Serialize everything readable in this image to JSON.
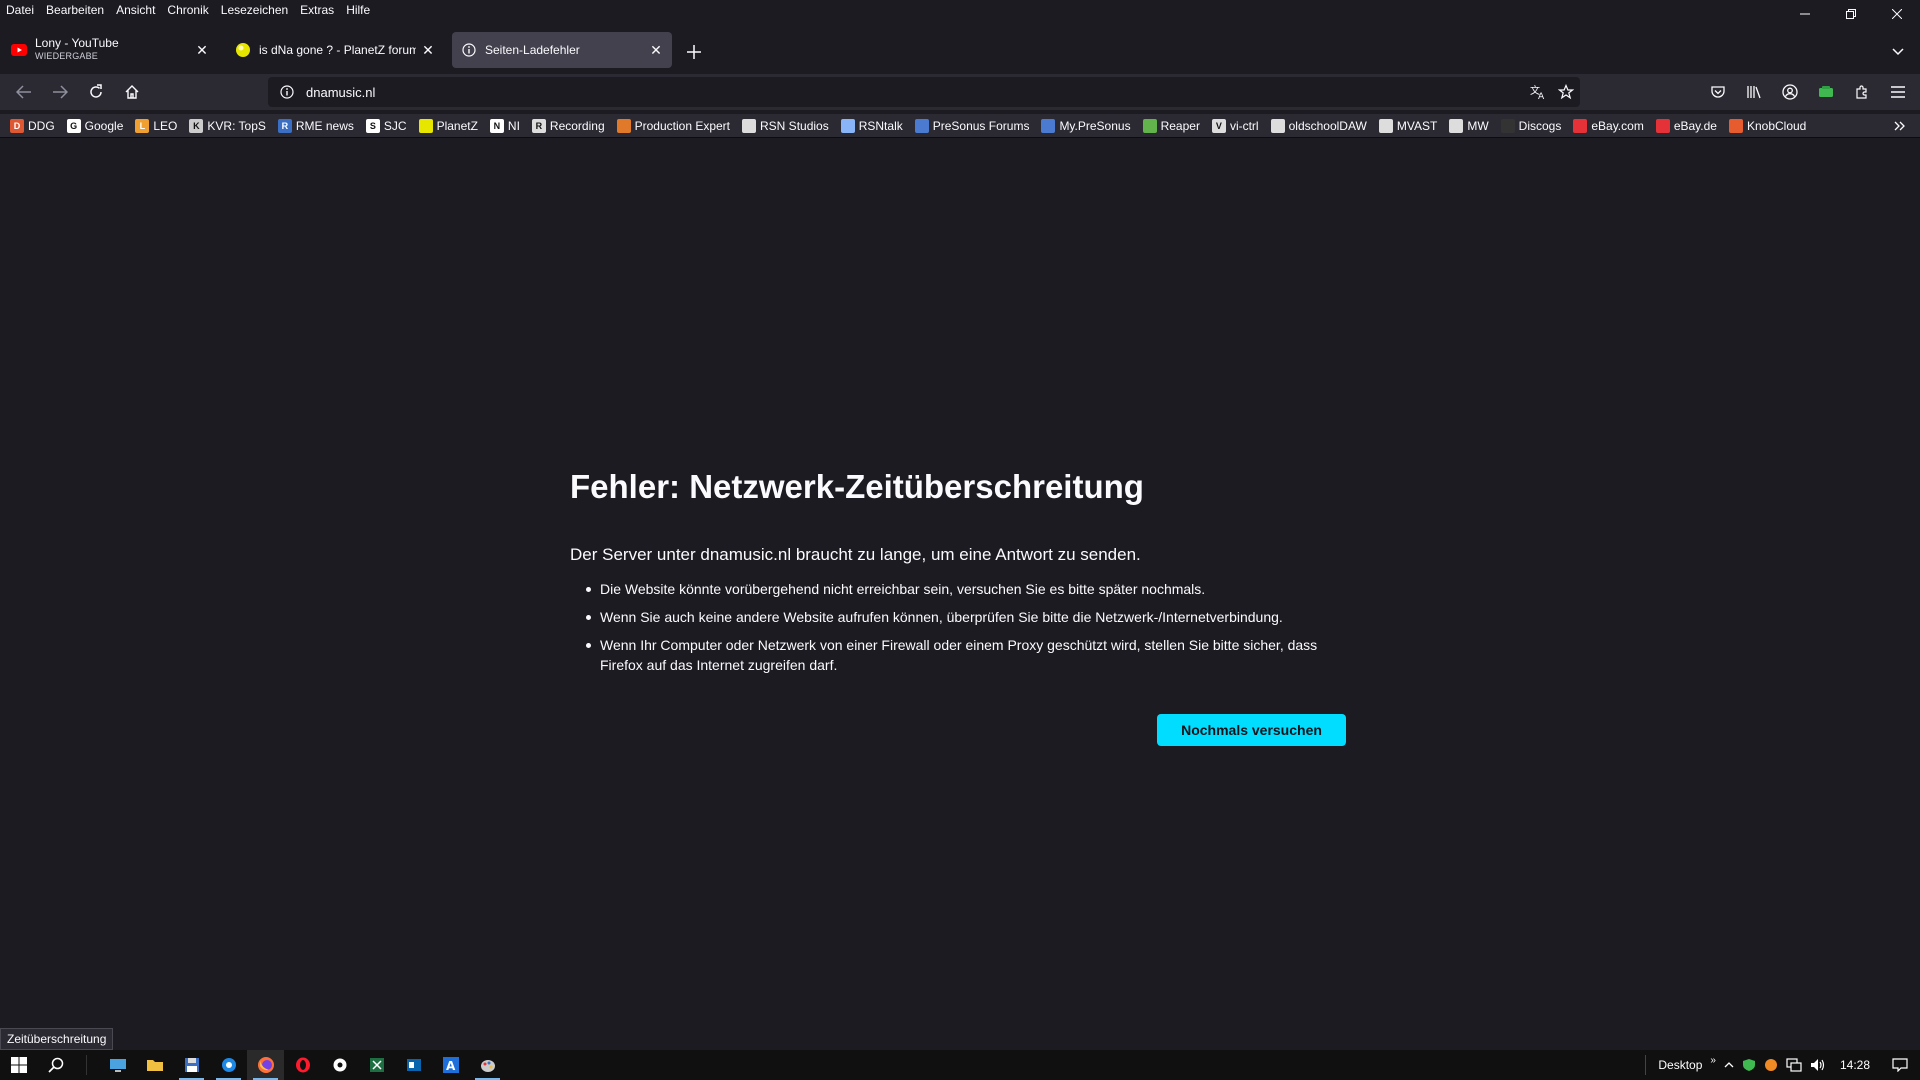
{
  "menu": [
    "Datei",
    "Bearbeiten",
    "Ansicht",
    "Chronik",
    "Lesezeichen",
    "Extras",
    "Hilfe"
  ],
  "tabs": [
    {
      "title": "Lony - YouTube",
      "subtitle": "WIEDERGABE",
      "icon": "youtube-icon"
    },
    {
      "title": "is dNa gone ? - PlanetZ forums",
      "icon": "planetz-icon"
    },
    {
      "title": "Seiten-Ladefehler",
      "icon": "info-icon"
    }
  ],
  "urlbar": {
    "value": "dnamusic.nl"
  },
  "bookmarks": [
    {
      "label": "DDG",
      "color": "#de5833",
      "glyph": "D"
    },
    {
      "label": "Google",
      "color": "#ffffff",
      "glyph": "G"
    },
    {
      "label": "LEO",
      "color": "#f0a030",
      "glyph": "L"
    },
    {
      "label": "KVR: TopS",
      "color": "#cccccc",
      "glyph": "K"
    },
    {
      "label": "RME news",
      "color": "#3a6fc4",
      "glyph": "R"
    },
    {
      "label": "SJC",
      "color": "#ffffff",
      "glyph": "S"
    },
    {
      "label": "PlanetZ",
      "color": "#e6e600",
      "glyph": ""
    },
    {
      "label": "NI",
      "color": "#ffffff",
      "glyph": "N"
    },
    {
      "label": "Recording",
      "color": "#dddddd",
      "glyph": "R"
    },
    {
      "label": "Production Expert",
      "color": "#e07a2a",
      "glyph": ""
    },
    {
      "label": "RSN Studios",
      "color": "#dddddd",
      "glyph": ""
    },
    {
      "label": "RSNtalk",
      "color": "#8ab4f8",
      "glyph": ""
    },
    {
      "label": "PreSonus Forums",
      "color": "#4a7bd0",
      "glyph": ""
    },
    {
      "label": "My.PreSonus",
      "color": "#4a7bd0",
      "glyph": ""
    },
    {
      "label": "Reaper",
      "color": "#62b34b",
      "glyph": ""
    },
    {
      "label": "vi-ctrl",
      "color": "#dddddd",
      "glyph": "V"
    },
    {
      "label": "oldschoolDAW",
      "color": "#dddddd",
      "glyph": ""
    },
    {
      "label": "MVAST",
      "color": "#dddddd",
      "glyph": ""
    },
    {
      "label": "MW",
      "color": "#dddddd",
      "glyph": ""
    },
    {
      "label": "Discogs",
      "color": "#333333",
      "glyph": ""
    },
    {
      "label": "eBay.com",
      "color": "#e53238",
      "glyph": ""
    },
    {
      "label": "eBay.de",
      "color": "#e53238",
      "glyph": ""
    },
    {
      "label": "KnobCloud",
      "color": "#e65c2e",
      "glyph": ""
    }
  ],
  "error": {
    "title": "Fehler: Netzwerk-Zeitüberschreitung",
    "description": "Der Server unter dnamusic.nl braucht zu lange, um eine Antwort zu senden.",
    "items": [
      "Die Website könnte vorübergehend nicht erreichbar sein, versuchen Sie es bitte später nochmals.",
      "Wenn Sie auch keine andere Website aufrufen können, überprüfen Sie bitte die Netzwerk-/Internetverbindung.",
      "Wenn Ihr Computer oder Netzwerk von einer Firewall oder einem Proxy geschützt wird, stellen Sie bitte sicher, dass Firefox auf das Internet zugreifen darf."
    ],
    "retry_label": "Nochmals versuchen"
  },
  "status_text": "Zeitüberschreitung",
  "taskbar": {
    "desktop_label": "Desktop",
    "time": "14:28"
  },
  "colors": {
    "accent": "#00ddff",
    "content_bg": "#1c1b22",
    "toolbar_bg": "#2b2a33"
  }
}
